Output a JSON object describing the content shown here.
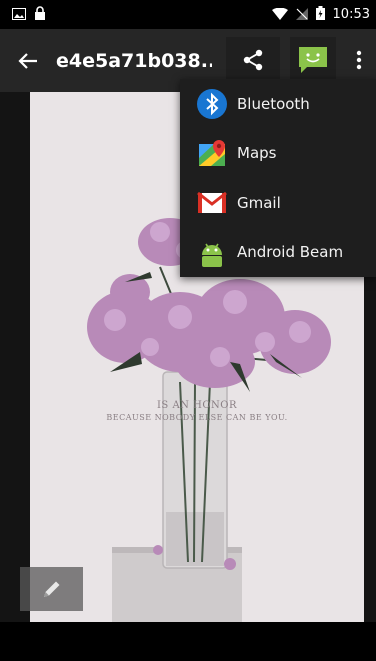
{
  "status_bar": {
    "time": "10:53"
  },
  "action_bar": {
    "title": "e4e5a71b038..."
  },
  "share_menu": {
    "items": [
      {
        "label": "Bluetooth",
        "icon": "bluetooth-icon"
      },
      {
        "label": "Maps",
        "icon": "maps-icon"
      },
      {
        "label": "Gmail",
        "icon": "gmail-icon"
      },
      {
        "label": "Android Beam",
        "icon": "android-beam-icon"
      }
    ]
  },
  "photo": {
    "caption_line1": "IS AN HONOR",
    "caption_line2": "BECAUSE NOBODY ELSE CAN BE YOU."
  },
  "colors": {
    "action_bar": "#262626",
    "messaging_green": "#8bc34a",
    "bluetooth_blue": "#1976d2",
    "gmail_red": "#d93025"
  }
}
